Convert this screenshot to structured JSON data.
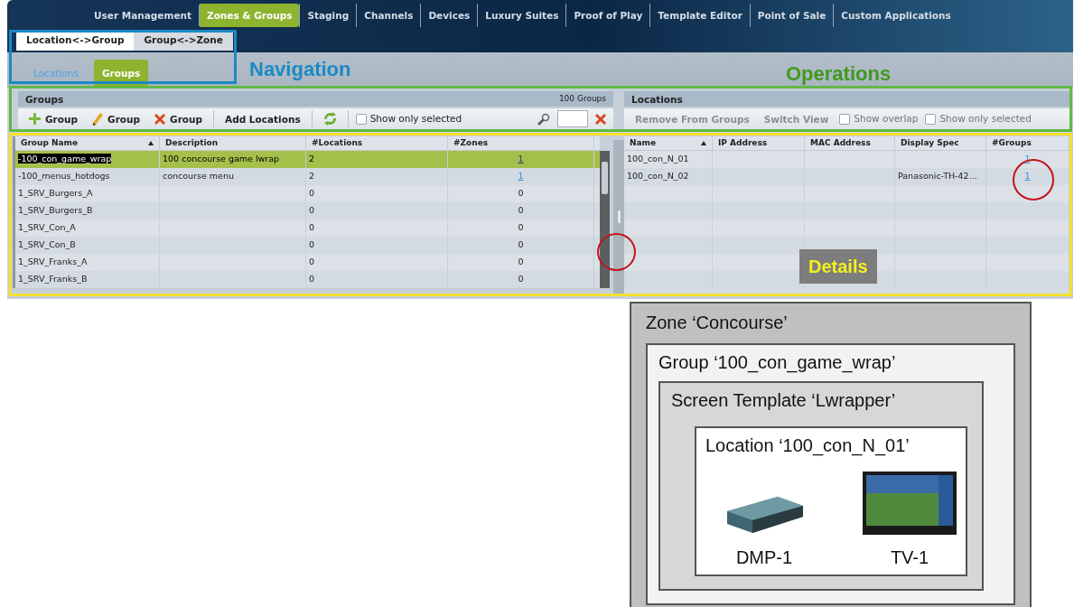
{
  "top_menu": [
    {
      "label": "User Management",
      "selected": false
    },
    {
      "label": "Zones & Groups",
      "selected": true
    },
    {
      "label": "Staging",
      "selected": false
    },
    {
      "label": "Channels",
      "selected": false
    },
    {
      "label": "Devices",
      "selected": false
    },
    {
      "label": "Luxury Suites",
      "selected": false
    },
    {
      "label": "Proof of Play",
      "selected": false
    },
    {
      "label": "Template Editor",
      "selected": false
    },
    {
      "label": "Point of Sale",
      "selected": false
    },
    {
      "label": "Custom Applications",
      "selected": false
    }
  ],
  "view_tabs": [
    {
      "label": "Location<->Group",
      "selected": true
    },
    {
      "label": "Group<->Zone",
      "selected": false
    }
  ],
  "sub_tabs": [
    {
      "label": "Locations",
      "selected": false
    },
    {
      "label": "Groups",
      "selected": true
    }
  ],
  "annotations": {
    "navigation": "Navigation",
    "operations": "Operations",
    "details": "Details"
  },
  "groups_panel": {
    "title": "Groups",
    "count": "100 Groups",
    "toolbar": [
      {
        "kind": "add",
        "label": "Group"
      },
      {
        "kind": "edit",
        "label": "Group"
      },
      {
        "kind": "delete",
        "label": "Group"
      },
      {
        "kind": "text",
        "label": "Add Locations"
      },
      {
        "kind": "refresh"
      },
      {
        "kind": "checkbox",
        "label": "Show only selected",
        "checked": false
      },
      {
        "kind": "search"
      }
    ],
    "columns": [
      {
        "label": "Group Name",
        "sorted": true
      },
      {
        "label": "Description",
        "sorted": false
      },
      {
        "label": "#Locations",
        "sorted": false
      },
      {
        "label": "#Zones",
        "sorted": false
      }
    ],
    "rows": [
      {
        "name": "-100_con_game_wrap",
        "description": "100 concourse game lwrap",
        "locations": "2",
        "zones": "1",
        "zones_link": true,
        "selected": true
      },
      {
        "name": "-100_menus_hotdogs",
        "description": "concourse menu",
        "locations": "2",
        "zones": "1",
        "zones_link": true,
        "selected": false
      },
      {
        "name": "1_SRV_Burgers_A",
        "description": "",
        "locations": "0",
        "zones": "0",
        "zones_link": false,
        "selected": false
      },
      {
        "name": "1_SRV_Burgers_B",
        "description": "",
        "locations": "0",
        "zones": "0",
        "zones_link": false,
        "selected": false
      },
      {
        "name": "1_SRV_Con_A",
        "description": "",
        "locations": "0",
        "zones": "0",
        "zones_link": false,
        "selected": false
      },
      {
        "name": "1_SRV_Con_B",
        "description": "",
        "locations": "0",
        "zones": "0",
        "zones_link": false,
        "selected": false
      },
      {
        "name": "1_SRV_Franks_A",
        "description": "",
        "locations": "0",
        "zones": "0",
        "zones_link": false,
        "selected": false
      },
      {
        "name": "1_SRV_Franks_B",
        "description": "",
        "locations": "0",
        "zones": "0",
        "zones_link": false,
        "selected": false
      }
    ]
  },
  "locations_panel": {
    "title": "Locations",
    "toolbar": [
      {
        "kind": "text",
        "label": "Remove From Groups"
      },
      {
        "kind": "text",
        "label": "Switch View"
      },
      {
        "kind": "checkbox",
        "label": "Show overlap",
        "checked": false
      },
      {
        "kind": "checkbox",
        "label": "Show only selected",
        "checked": false
      }
    ],
    "columns": [
      {
        "label": "Name",
        "sorted": true
      },
      {
        "label": "IP Address",
        "sorted": false
      },
      {
        "label": "MAC Address",
        "sorted": false
      },
      {
        "label": "Display Spec",
        "sorted": false
      },
      {
        "label": "#Groups",
        "sorted": false
      }
    ],
    "rows": [
      {
        "name": "100_con_N_01",
        "ip": "",
        "mac": "",
        "display_spec": "",
        "groups": "1"
      },
      {
        "name": "100_con_N_02",
        "ip": "",
        "mac": "",
        "display_spec": "Panasonic-TH-42...",
        "groups": "1"
      }
    ]
  },
  "diagram": {
    "zone": "Zone ‘Concourse’",
    "group": "Group ‘100_con_game_wrap’",
    "template": "Screen Template ‘Lwrapper’",
    "location": "Location ‘100_con_N_01’",
    "devices": [
      {
        "kind": "player",
        "label": "DMP-1"
      },
      {
        "kind": "display",
        "label": "TV-1"
      }
    ]
  }
}
